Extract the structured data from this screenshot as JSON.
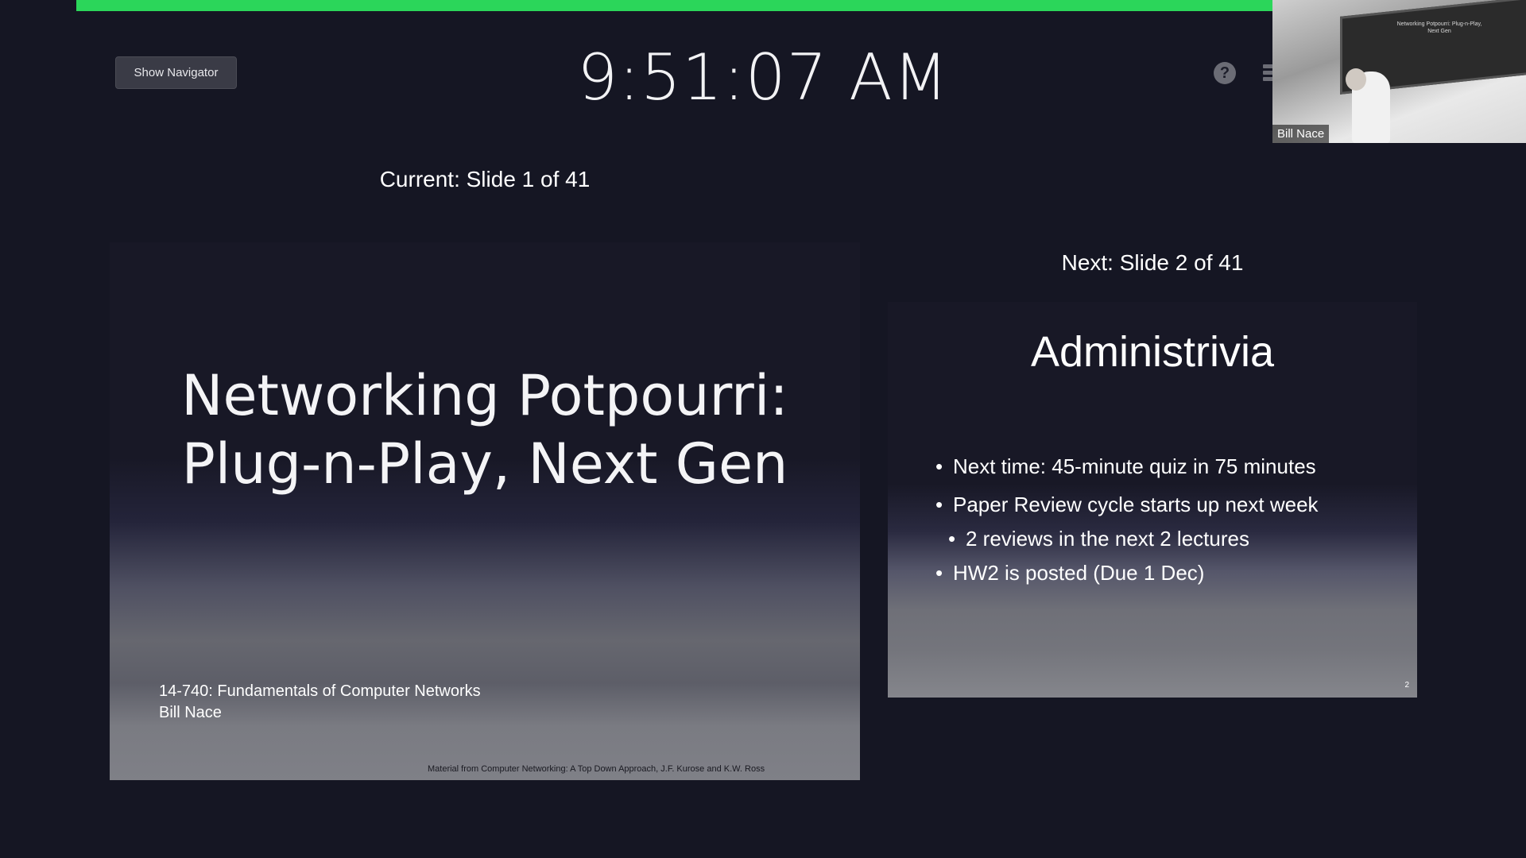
{
  "toolbar": {
    "show_navigator_label": "Show Navigator",
    "clock": "9:51:07 AM",
    "help_icon": "question-circle-icon",
    "settings_icon": "menu-icon"
  },
  "video": {
    "participant_name": "Bill Nace",
    "screen_text": "Networking Potpourri: Plug-n-Play, Next Gen"
  },
  "current": {
    "label": "Current: Slide 1 of 41",
    "title_line1": "Networking Potpourri:",
    "title_line2": "Plug-n-Play, Next Gen",
    "course": "14-740: Fundamentals of Computer Networks",
    "author": "Bill Nace",
    "credit": "Material from Computer Networking: A Top Down Approach, J.F. Kurose and K.W. Ross"
  },
  "next": {
    "label": "Next: Slide 2 of 41",
    "heading": "Administrivia",
    "bullets": [
      "Next time: 45-minute quiz in 75 minutes",
      "Paper Review cycle starts up next week",
      "2 reviews in the next 2 lectures",
      "HW2 is posted (Due 1 Dec)"
    ],
    "page_number": "2"
  },
  "colors": {
    "share_bar": "#2bd65a",
    "background": "#151623"
  }
}
